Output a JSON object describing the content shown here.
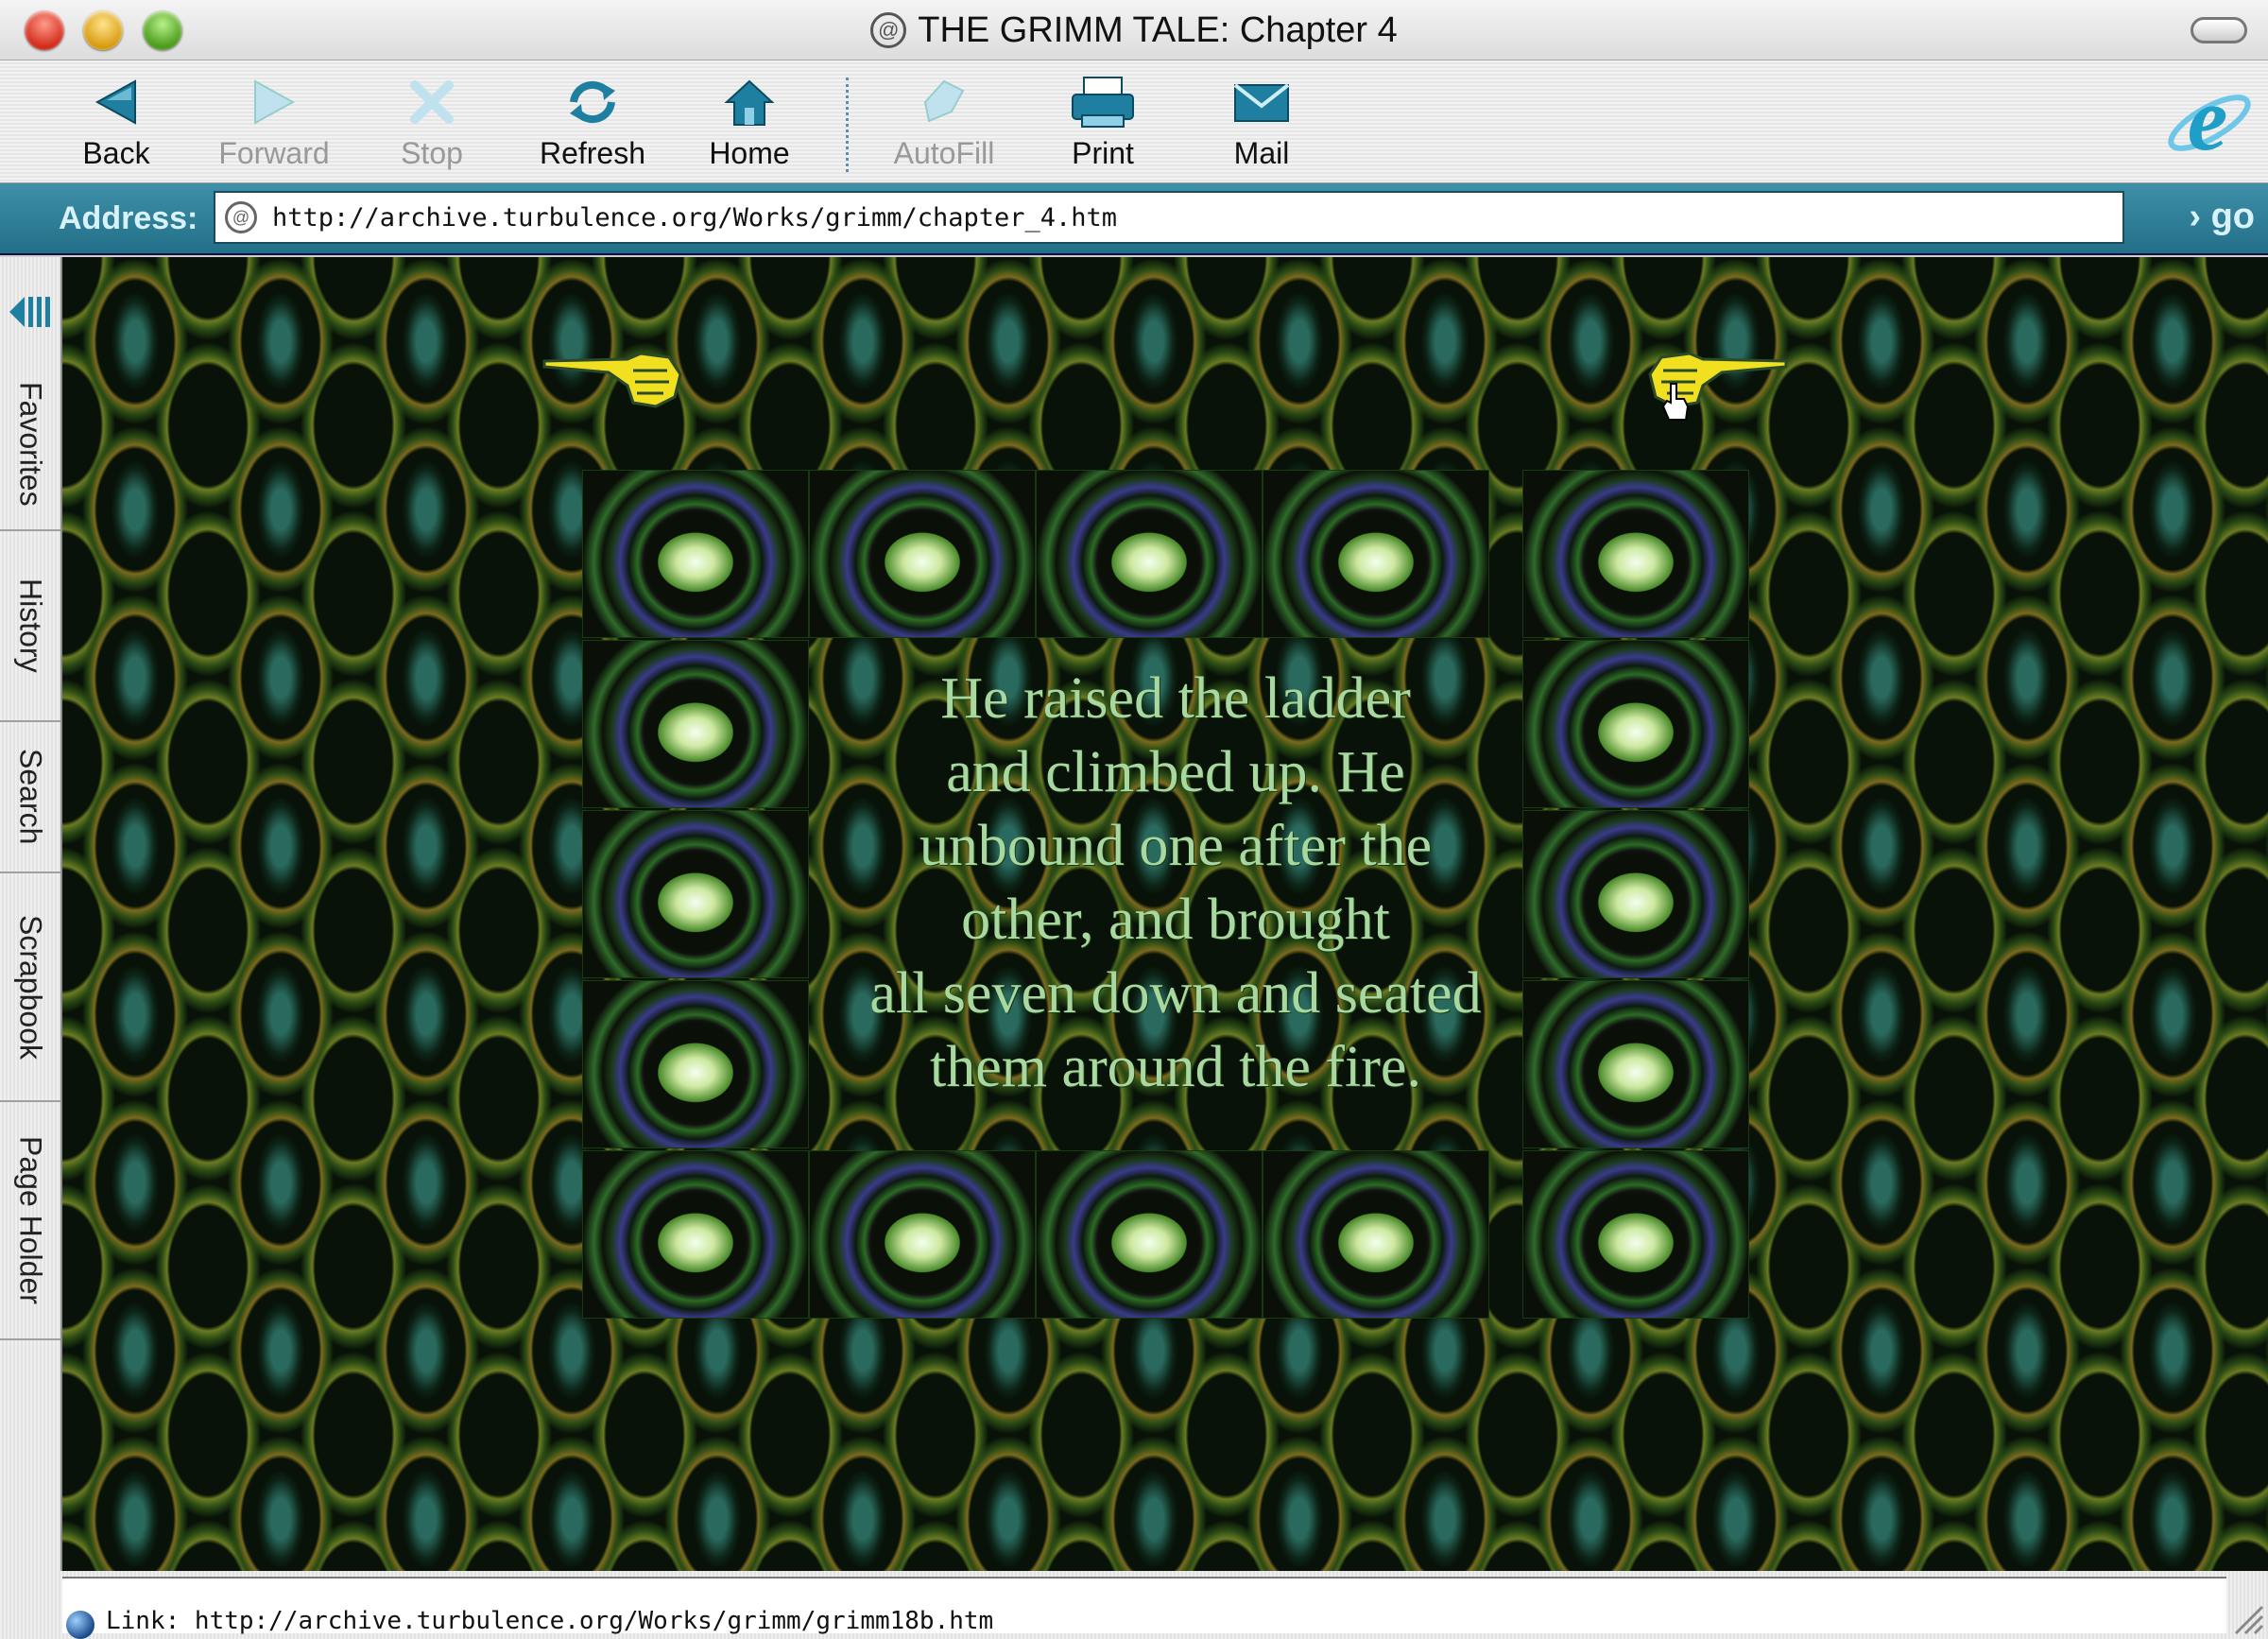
{
  "window": {
    "title": "THE GRIMM TALE: Chapter 4",
    "title_icon": "@"
  },
  "toolbar": {
    "buttons": [
      {
        "label": "Back",
        "icon": "back-arrow-icon",
        "enabled": true
      },
      {
        "label": "Forward",
        "icon": "forward-arrow-icon",
        "enabled": false
      },
      {
        "label": "Stop",
        "icon": "stop-x-icon",
        "enabled": false
      },
      {
        "label": "Refresh",
        "icon": "refresh-icon",
        "enabled": true
      },
      {
        "label": "Home",
        "icon": "home-icon",
        "enabled": true
      },
      {
        "label": "AutoFill",
        "icon": "autofill-icon",
        "enabled": false
      },
      {
        "label": "Print",
        "icon": "printer-icon",
        "enabled": true
      },
      {
        "label": "Mail",
        "icon": "mail-icon",
        "enabled": true
      }
    ]
  },
  "address": {
    "label": "Address:",
    "url": "http://archive.turbulence.org/Works/grimm/chapter_4.htm",
    "go_label": "› go"
  },
  "sidebar": {
    "tabs": [
      "Favorites",
      "History",
      "Search",
      "Scrapbook",
      "Page Holder"
    ]
  },
  "page": {
    "text": "He raised the ladder and climbed up. He unbound one after the other, and brought all seven down and seated them around the fire.",
    "lines": [
      "He raised the ladder",
      "and climbed up. He",
      "unbound one after the",
      "other, and brought",
      "all seven down and seated",
      "them around the fire."
    ],
    "left_hand": "pointing-hand-right-icon",
    "right_hand": "pointing-hand-left-icon"
  },
  "status": {
    "text": "Link: http://archive.turbulence.org/Works/grimm/grimm18b.htm"
  },
  "colors": {
    "address_bar": "#2b7f99",
    "page_text": "#a8d8a0",
    "hand_yellow": "#f0e020"
  }
}
